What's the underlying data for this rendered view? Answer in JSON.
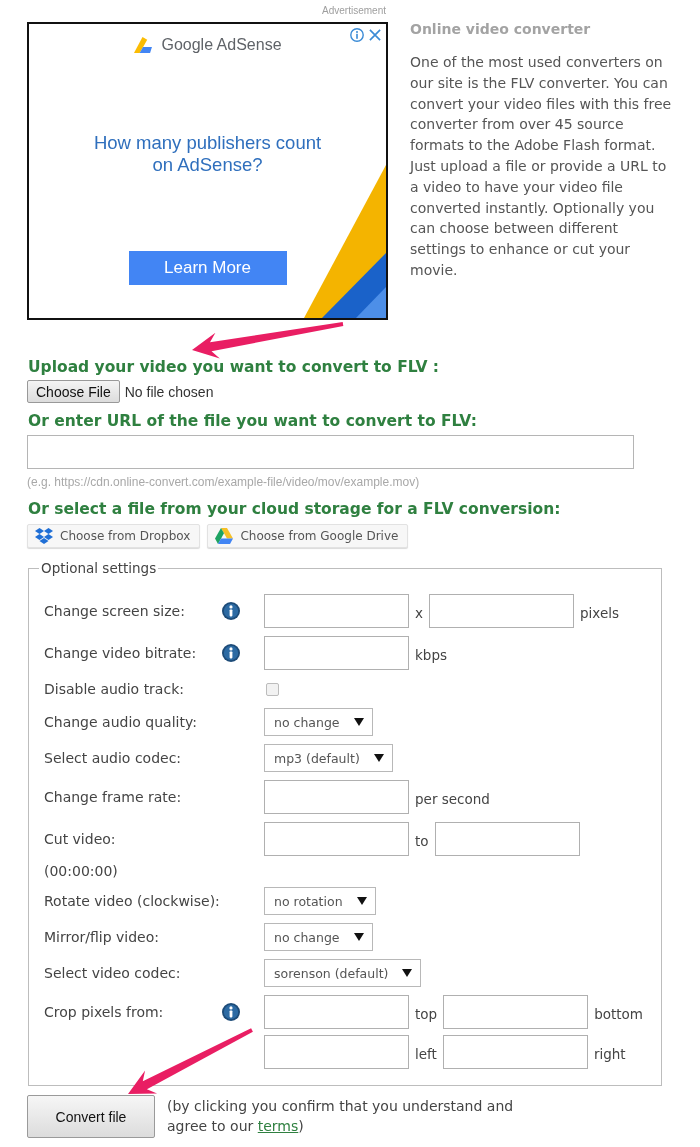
{
  "advertisement": {
    "label": "Advertisement",
    "brand": "Google AdSense",
    "headline": "How many publishers count on AdSense?",
    "button": "Learn More"
  },
  "intro": {
    "title": "Online video converter",
    "text": "One of the most used converters on our site is the FLV converter. You can convert your video files with this free converter from over 45 source formats to the Adobe Flash format. Just upload a file or provide a URL to a video to have your video file converted instantly. Optionally you can choose between different settings to enhance or cut your movie."
  },
  "upload": {
    "heading": "Upload your video you want to convert to FLV :",
    "button": "Choose File",
    "status": "No file chosen"
  },
  "url": {
    "heading": "Or enter URL of the file you want to convert to FLV:",
    "hint": "(e.g. https://cdn.online-convert.com/example-file/video/mov/example.mov)"
  },
  "cloud": {
    "heading": "Or select a file from your cloud storage for a FLV conversion:",
    "buttons": [
      {
        "kind": "dropbox",
        "label": "Choose from Dropbox"
      },
      {
        "kind": "drive",
        "label": "Choose from Google Drive"
      }
    ]
  },
  "settings": {
    "legend": "Optional settings",
    "rows": [
      {
        "label": "Change screen size:",
        "info": true,
        "lines": [
          [
            {
              "kind": "input"
            },
            {
              "kind": "unit",
              "text": "x"
            },
            {
              "kind": "input"
            },
            {
              "kind": "unit",
              "text": "pixels"
            }
          ]
        ]
      },
      {
        "label": "Change video bitrate:",
        "info": true,
        "lines": [
          [
            {
              "kind": "input"
            },
            {
              "kind": "unit",
              "text": "kbps"
            }
          ]
        ]
      },
      {
        "label": "Disable audio track:",
        "info": false,
        "lines": [
          [
            {
              "kind": "checkbox",
              "checked": false
            }
          ]
        ]
      },
      {
        "label": "Change audio quality:",
        "info": false,
        "lines": [
          [
            {
              "kind": "select",
              "value": "no change"
            }
          ]
        ]
      },
      {
        "label": "Select audio codec:",
        "info": false,
        "lines": [
          [
            {
              "kind": "select",
              "value": "mp3 (default)"
            }
          ]
        ]
      },
      {
        "label": "Change frame rate:",
        "info": false,
        "lines": [
          [
            {
              "kind": "input"
            },
            {
              "kind": "unit",
              "text": "per second"
            }
          ]
        ]
      },
      {
        "label": "Cut video:",
        "info": false,
        "lines": [
          [
            {
              "kind": "input"
            },
            {
              "kind": "unit",
              "text": "to"
            },
            {
              "kind": "input"
            }
          ]
        ],
        "note": "(00:00:00)"
      },
      {
        "label": "Rotate video (clockwise):",
        "info": false,
        "lines": [
          [
            {
              "kind": "select",
              "value": "no rotation"
            }
          ]
        ]
      },
      {
        "label": "Mirror/flip video:",
        "info": false,
        "lines": [
          [
            {
              "kind": "select",
              "value": "no change"
            }
          ]
        ]
      },
      {
        "label": "Select video codec:",
        "info": false,
        "lines": [
          [
            {
              "kind": "select",
              "value": "sorenson (default)"
            }
          ]
        ]
      },
      {
        "label": "Crop pixels from:",
        "info": true,
        "lines": [
          [
            {
              "kind": "input"
            },
            {
              "kind": "unit",
              "text": "top"
            },
            {
              "kind": "input"
            },
            {
              "kind": "unit",
              "text": "bottom"
            }
          ],
          [
            {
              "kind": "input"
            },
            {
              "kind": "unit",
              "text": "left"
            },
            {
              "kind": "input"
            },
            {
              "kind": "unit",
              "text": "right"
            }
          ]
        ]
      }
    ]
  },
  "convert": {
    "button": "Convert file",
    "note": "(by clicking you confirm that you understand and agree to our ",
    "link": "terms",
    "note_end": ")"
  }
}
